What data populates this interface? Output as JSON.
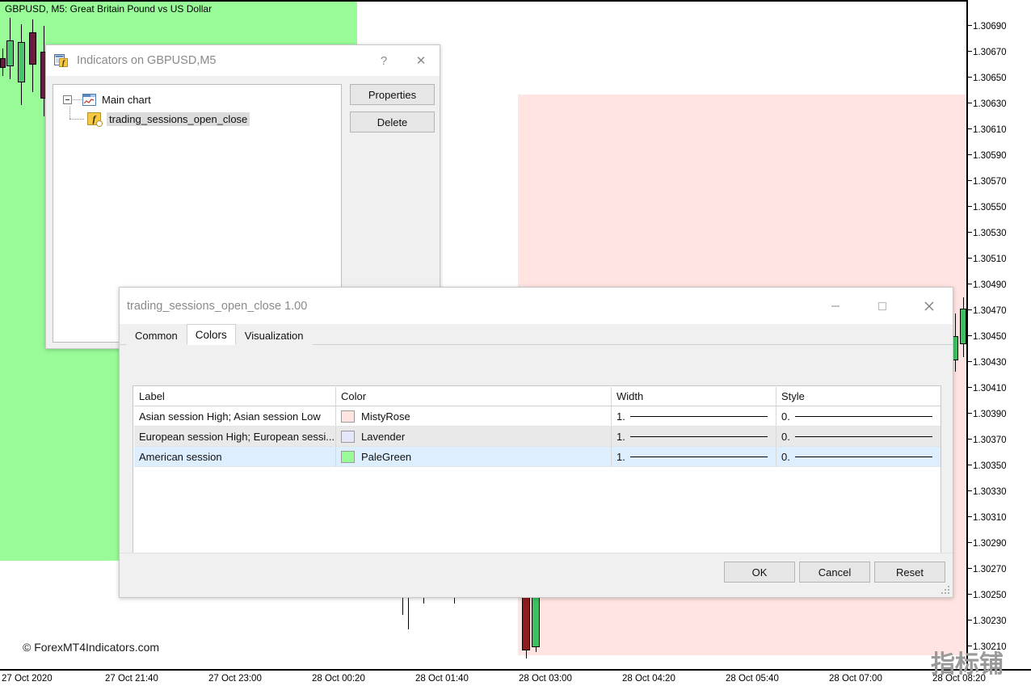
{
  "chart": {
    "title": "GBPUSD, M5:  Great Britain Pound vs US Dollar",
    "symbol": "GBPUSD",
    "timeframe": "M5",
    "credit": "© ForexMT4Indicators.com",
    "watermark": "指标铺",
    "price_ticks": [
      "1.30690",
      "1.30670",
      "1.30650",
      "1.30630",
      "1.30610",
      "1.30590",
      "1.30570",
      "1.30550",
      "1.30530",
      "1.30510",
      "1.30490",
      "1.30470",
      "1.30450",
      "1.30430",
      "1.30410",
      "1.30390",
      "1.30370",
      "1.30350",
      "1.30330",
      "1.30310",
      "1.30290",
      "1.30270",
      "1.30250",
      "1.30230",
      "1.30210"
    ],
    "time_ticks": [
      "27 Oct 2020",
      "27 Oct 21:40",
      "27 Oct 23:00",
      "28 Oct 00:20",
      "28 Oct 01:40",
      "28 Oct 03:00",
      "28 Oct 04:20",
      "28 Oct 05:40",
      "28 Oct 07:00",
      "28 Oct 08:20"
    ],
    "colors": {
      "asian_session": "#ffe4e1",
      "european_session": "#e6e6fa",
      "american_session": "#98fb98",
      "bull_body": "#49c46a",
      "bear_body": "#6e1b3e"
    }
  },
  "indicators_window": {
    "title": "Indicators on GBPUSD,M5",
    "icon": "indicator-list-icon",
    "help_label": "?",
    "close_label": "✕",
    "tree": {
      "root_label": "Main chart",
      "root_icon": "chart-icon",
      "child_label": "trading_sessions_open_close",
      "child_icon": "function-icon"
    },
    "buttons": {
      "properties": "Properties",
      "delete": "Delete"
    }
  },
  "properties_dialog": {
    "title": "trading_sessions_open_close 1.00",
    "minimize_label": "─",
    "maximize_label": "□",
    "close_label": "✕",
    "tabs": [
      {
        "label": "Common",
        "active": false
      },
      {
        "label": "Colors",
        "active": true
      },
      {
        "label": "Visualization",
        "active": false
      }
    ],
    "grid": {
      "headers": [
        "Label",
        "Color",
        "Width",
        "Style"
      ],
      "rows": [
        {
          "label": "Asian session High; Asian session Low",
          "color_name": "MistyRose",
          "color_hex": "#ffe4e1",
          "width": "1.",
          "style": "0.",
          "row_state": "normal"
        },
        {
          "label": "European session High; European sessi...",
          "color_name": "Lavender",
          "color_hex": "#e6e6fa",
          "width": "1.",
          "style": "0.",
          "row_state": "alt"
        },
        {
          "label": "American session",
          "color_name": "PaleGreen",
          "color_hex": "#98fb98",
          "width": "1.",
          "style": "0.",
          "row_state": "selected"
        }
      ]
    },
    "footer_buttons": {
      "ok": "OK",
      "cancel": "Cancel",
      "reset": "Reset"
    }
  }
}
